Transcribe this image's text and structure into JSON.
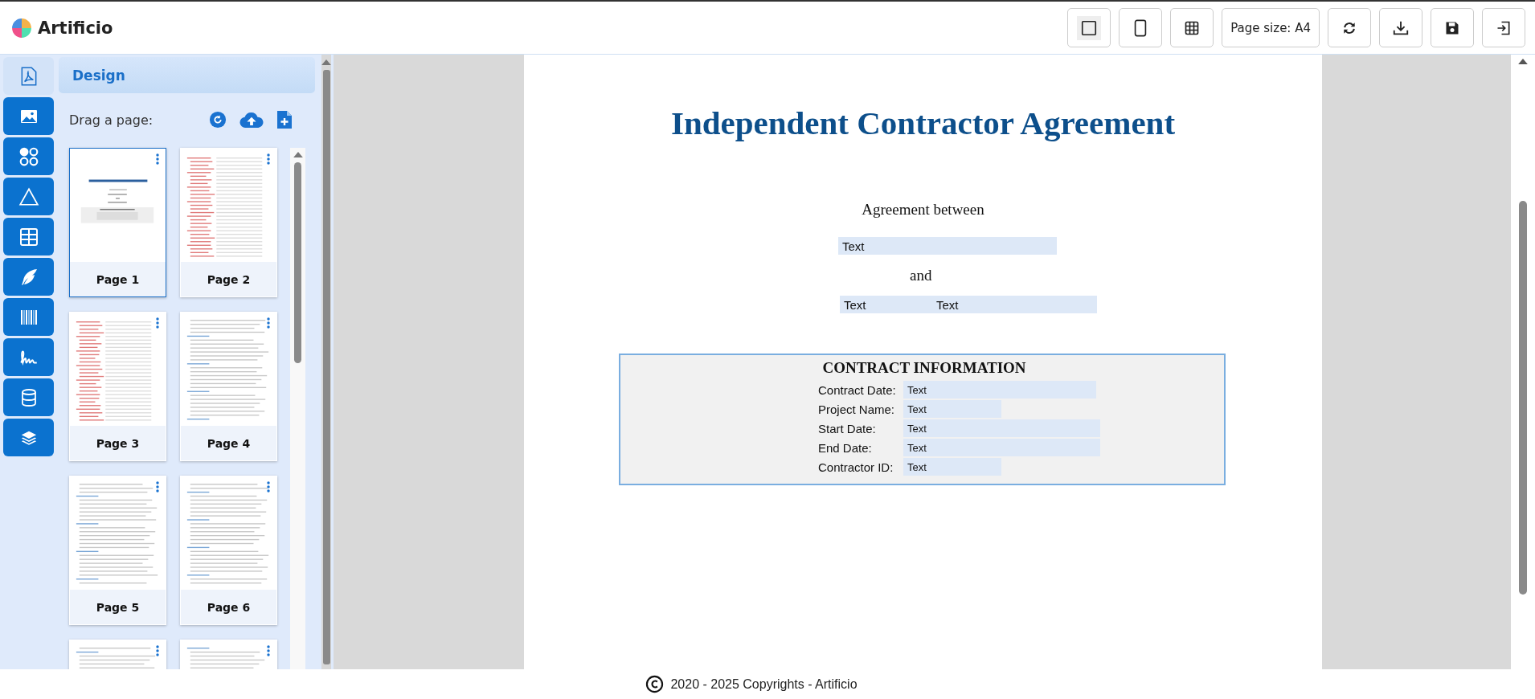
{
  "app": {
    "name": "Artificio"
  },
  "toolbar": [
    {
      "kind": "square",
      "selected": true
    },
    {
      "kind": "portrait",
      "selected": false
    },
    {
      "kind": "grid",
      "selected": false
    },
    {
      "kind": "text",
      "label": "Page size: A4"
    },
    {
      "kind": "refresh"
    },
    {
      "kind": "download"
    },
    {
      "kind": "save"
    },
    {
      "kind": "exit"
    }
  ],
  "tools": [
    {
      "kind": "pdf",
      "selected": true
    },
    {
      "kind": "image",
      "selected": false
    },
    {
      "kind": "shapes",
      "selected": false
    },
    {
      "kind": "triangle",
      "selected": false
    },
    {
      "kind": "table",
      "selected": false
    },
    {
      "kind": "feather",
      "selected": false
    },
    {
      "kind": "barcode",
      "selected": false
    },
    {
      "kind": "signature",
      "selected": false
    },
    {
      "kind": "database",
      "selected": false
    },
    {
      "kind": "layers",
      "selected": false
    }
  ],
  "panel": {
    "title": "Design",
    "drag_label": "Drag a page:"
  },
  "pages": [
    {
      "label": "Page 1",
      "selected": true,
      "kind": "cover"
    },
    {
      "label": "Page 2",
      "selected": false,
      "kind": "contents"
    },
    {
      "label": "Page 3",
      "selected": false,
      "kind": "contents"
    },
    {
      "label": "Page 4",
      "selected": false,
      "kind": "text"
    },
    {
      "label": "Page 5",
      "selected": false,
      "kind": "text"
    },
    {
      "label": "Page 6",
      "selected": false,
      "kind": "text"
    },
    {
      "selected": false,
      "kind": "text"
    },
    {
      "selected": false,
      "kind": "text"
    }
  ],
  "document": {
    "title": "Independent Contractor Agreement",
    "between": "Agreement between",
    "party_1": "Text",
    "and": "and",
    "party_2": [
      "Text",
      "Text"
    ],
    "info_title": "CONTRACT INFORMATION",
    "info_rows": [
      {
        "label": "Contract Date:",
        "value": "Text"
      },
      {
        "label": "Project Name:",
        "value": "Text"
      },
      {
        "label": "Start Date:",
        "value": "Text"
      },
      {
        "label": "End Date:",
        "value": "Text"
      },
      {
        "label": "Contractor ID:",
        "value": "Text"
      }
    ]
  },
  "footer": {
    "text": "2020 - 2025 Copyrights - Artificio"
  }
}
